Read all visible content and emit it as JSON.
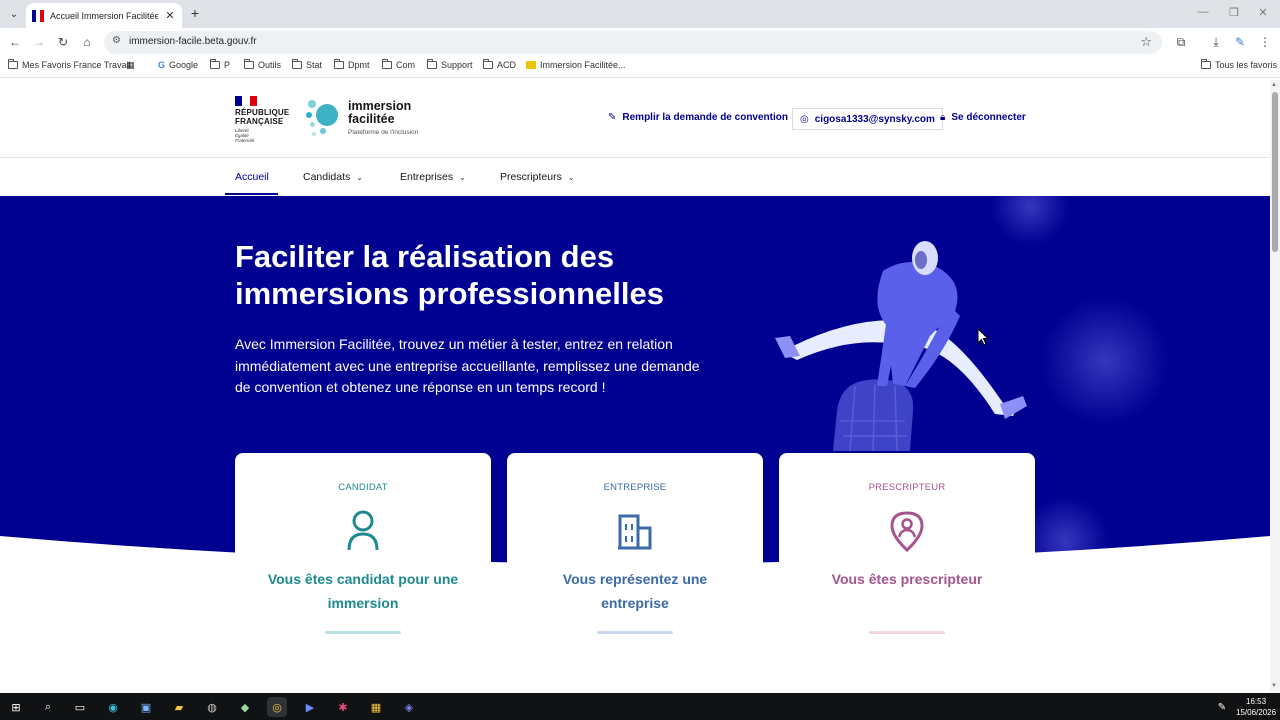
{
  "browser": {
    "tab_title": "Accueil Immersion Facilitée - Pl",
    "url": "immersion-facile.beta.gouv.fr",
    "bookmarks": [
      {
        "label": "Mes Favoris France Travail"
      },
      {
        "label": "Google"
      },
      {
        "label": "P"
      },
      {
        "label": "Outils"
      },
      {
        "label": "Stat"
      },
      {
        "label": "Dpmt"
      },
      {
        "label": "Com"
      },
      {
        "label": "Support"
      },
      {
        "label": "ACD"
      },
      {
        "label": "Immersion Facilitée..."
      }
    ],
    "all_bookmarks": "Tous les favoris"
  },
  "header": {
    "republique_line1": "RÉPUBLIQUE",
    "republique_line2": "FRANÇAISE",
    "motto1": "Liberté",
    "motto2": "Égalité",
    "motto3": "Fraternité",
    "brand_name1": "immersion",
    "brand_name2": "facilitée",
    "brand_sub": "Plateforme de l'inclusion",
    "convention_link": "Remplir la demande de convention",
    "user_email": "cigosa1333@synsky.com",
    "logout": "Se déconnecter"
  },
  "nav": {
    "items": [
      {
        "label": "Accueil"
      },
      {
        "label": "Candidats"
      },
      {
        "label": "Entreprises"
      },
      {
        "label": "Prescripteurs"
      }
    ]
  },
  "hero": {
    "title_line1": "Faciliter la réalisation des",
    "title_line2": "immersions professionnelles",
    "text": "Avec Immersion Facilitée, trouvez un métier à tester, entrez en relation immédiatement avec une entreprise accueillante, remplissez une demande de convention et obtenez une réponse en un temps record !"
  },
  "cards": [
    {
      "kicker": "CANDIDAT",
      "line1": "Vous êtes candidat pour une",
      "line2": "immersion",
      "color": "#1e8a8f",
      "bar": "#b9dfe1"
    },
    {
      "kicker": "ENTREPRISE",
      "line1": "Vous représentez une",
      "line2": "entreprise",
      "color": "#3b6aa8",
      "bar": "#c9d8ea"
    },
    {
      "kicker": "PRESCRIPTEUR",
      "line1": "Vous êtes prescripteur",
      "line2": "",
      "color": "#a5548e",
      "bar": "#efd6e2"
    }
  ],
  "colors": {
    "primary": "#000091",
    "white": "#ffffff"
  },
  "taskbar": {
    "time": "16:53",
    "date": "15/06/2026"
  }
}
